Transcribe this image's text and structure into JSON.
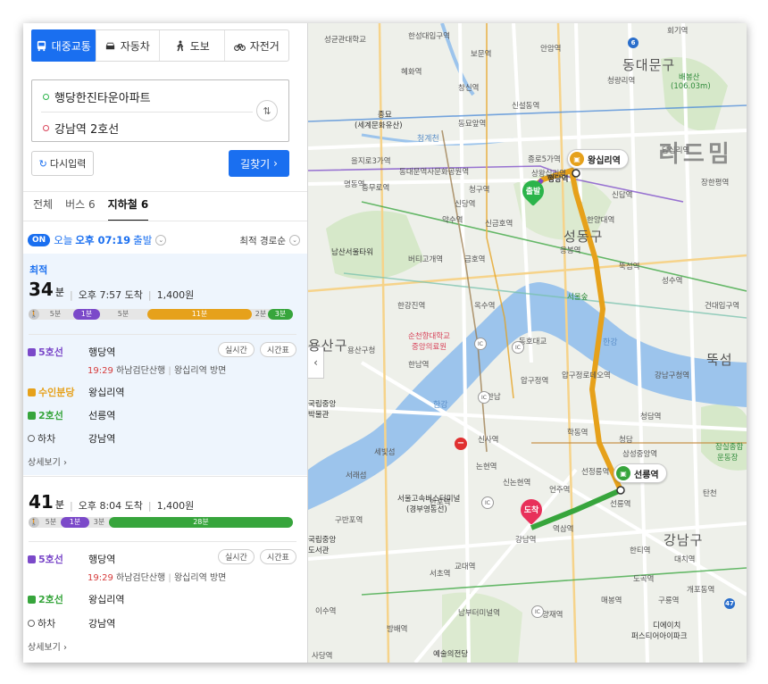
{
  "modes": [
    {
      "label": "대중교통",
      "icon": "bus-icon",
      "active": true
    },
    {
      "label": "자동차",
      "icon": "car-icon",
      "active": false
    },
    {
      "label": "도보",
      "icon": "walk-icon",
      "active": false
    },
    {
      "label": "자전거",
      "icon": "bicycle-icon",
      "active": false
    }
  ],
  "route": {
    "origin": "행당한진타운아파트",
    "destination": "강남역 2호선",
    "swap_icon": "⇅"
  },
  "actions": {
    "reset_label": "다시입력",
    "search_label": "길찾기"
  },
  "filter_tabs": [
    {
      "label": "전체",
      "active": false
    },
    {
      "label": "버스 6",
      "active": false
    },
    {
      "label": "지하철 6",
      "active": true
    }
  ],
  "time_row": {
    "on_badge": "ON",
    "today": "오늘",
    "clock": "오후 07:19",
    "depart": "출발",
    "sort": "최적 경로순"
  },
  "routes": [
    {
      "best_tag": "최적",
      "minutes": "34",
      "minutes_unit": "분",
      "arrive": "오후 7:57 도착",
      "fare": "1,400원",
      "bar": {
        "walk1": "5분",
        "bus": "1분",
        "walk2": "5분",
        "bundang": "11분",
        "walk3": "2분",
        "line2": "3분"
      },
      "legs": [
        {
          "line": "5호선",
          "station": "행당역",
          "sub_time": "19:29",
          "sub_dir": "하남검단산행",
          "sub_exit": "왕십리역 방면"
        },
        {
          "line": "수인분당",
          "station": "왕십리역"
        },
        {
          "line": "2호선",
          "station": "선릉역"
        },
        {
          "line": "하차",
          "station": "강남역"
        }
      ],
      "pills": [
        "실시간",
        "시간표"
      ],
      "more": "상세보기"
    },
    {
      "minutes": "41",
      "minutes_unit": "분",
      "arrive": "오후 8:04 도착",
      "fare": "1,400원",
      "bar": {
        "walk1": "5분",
        "bus": "1분",
        "walk2": "3분",
        "line2": "28분"
      },
      "legs": [
        {
          "line": "5호선",
          "station": "행당역",
          "sub_time": "19:29",
          "sub_dir": "하남검단산행",
          "sub_exit": "왕십리역 방면"
        },
        {
          "line": "2호선",
          "station": "왕십리역"
        },
        {
          "line": "하차",
          "station": "강남역"
        }
      ],
      "pills": [
        "실시간",
        "시간표"
      ],
      "more": "상세보기"
    }
  ],
  "map": {
    "watermark": "리드밈",
    "pins": {
      "wangsimni": "왕십리역",
      "seolleung": "선릉역",
      "start": "출발",
      "arrive": "도착",
      "haengdang": "행당역"
    },
    "labels": {
      "l1": "성균관대학교",
      "l2": "한성대입구역",
      "l3": "보문역",
      "l4": "안암역",
      "l5": "동대문구",
      "l6": "회기역",
      "l7": "혜화역",
      "l8": "창신역",
      "l9": "신설동역",
      "l10": "배봉산",
      "l11": "(106.03m)",
      "l12": "청량리역",
      "l13": "종묘",
      "l14": "(세계문화유산)",
      "l15": "동묘앞역",
      "l16": "청계천",
      "l17": "을지로3가역",
      "l18": "동대문역사문화공원역",
      "l19": "왕십리역",
      "l20": "신답역",
      "l21": "충무로역",
      "l22": "청구역",
      "l23": "상왕십리역",
      "l24": "약수역",
      "l25": "신금호역",
      "l26": "명동역",
      "l27": "남산서울타워",
      "l28": "금호역",
      "l29": "버티고개역",
      "l30": "성동구",
      "l31": "응봉역",
      "l32": "성수역",
      "l33": "건대입구역",
      "l34": "한강진역",
      "l35": "옥수역",
      "l36": "순천향대학교",
      "l37": "중앙의료원",
      "l38": "한남역",
      "l39": "서울숲",
      "l40": "한강",
      "l41": "용산구청",
      "l42": "동호대교",
      "l43": "압구정로데오역",
      "l44": "뚝섬",
      "l45": "압구정역",
      "l46": "청담역",
      "l47": "한남",
      "l48": "신사역",
      "l49": "강남구청역",
      "l50": "잠실종합",
      "l51": "운동장",
      "l52": "국립중앙",
      "l53": "박물관",
      "l54": "세빛섬",
      "l55": "논현역",
      "l56": "서래섬",
      "l57": "선정릉역",
      "l58": "삼성중앙역",
      "l59": "반포역",
      "l60": "서울고속버스터미널",
      "l61": "(경부영동선)",
      "l62": "언주역",
      "l63": "구반포역",
      "l64": "탄천",
      "l65": "강남구",
      "l66": "국립중앙",
      "l67": "도서관",
      "l68": "국립",
      "l69": "한티역",
      "l70": "대치역",
      "l71": "교대역",
      "l72": "서초역",
      "l73": "도곡역",
      "l74": "개포동역",
      "l75": "이수역",
      "l76": "양재역",
      "l77": "남부터미널역",
      "l78": "매봉역",
      "l79": "구룡역",
      "l80": "디에이치",
      "l81": "퍼스티어아이파크",
      "l82": "방배역",
      "l83": "예술의전당",
      "l84": "사당역",
      "l85": "강남역",
      "l86": "선릉역",
      "l87": "종로5가역",
      "l88": "장한평역",
      "l89": "신당역",
      "l90": "답십리역",
      "l91": "중구",
      "l92": "한양대역",
      "l93": "뚝섬역",
      "l94": "용산구",
      "l95": "신용산역",
      "l96": "청담",
      "l97": "학동역",
      "l98": "신논현역",
      "l99": "역삼역",
      "l100": "마천",
      "l101": "가락",
      "l102": "한강공원"
    },
    "badge_ic": "IC",
    "hw1": "6",
    "hw2": "47",
    "collapse_icon": "‹"
  }
}
